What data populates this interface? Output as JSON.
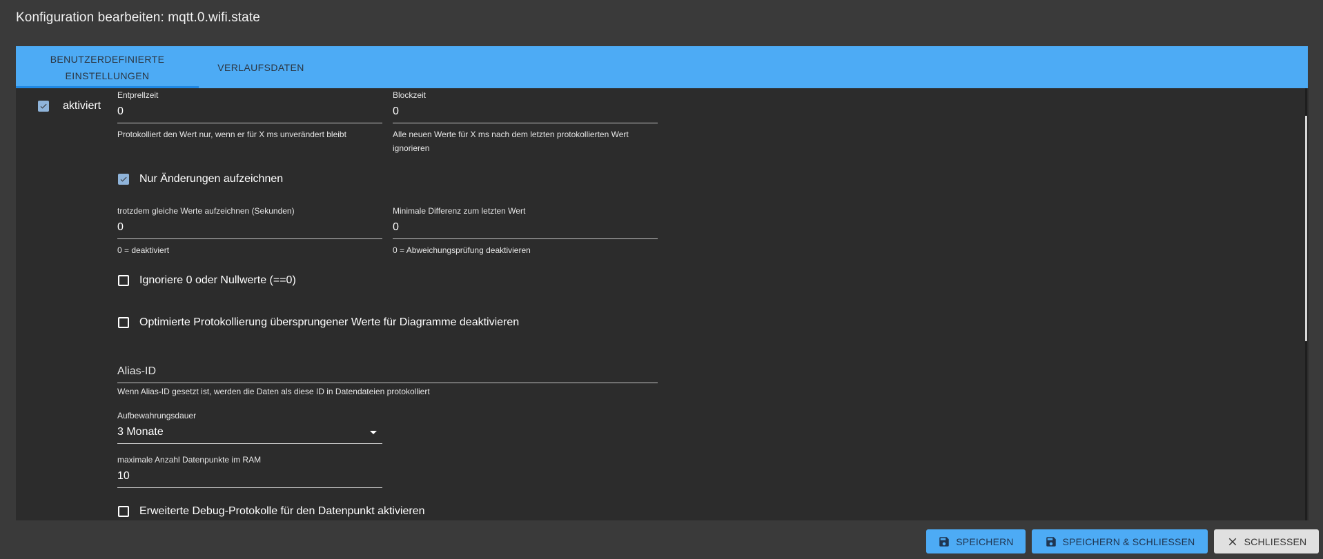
{
  "dialog": {
    "title": "Konfiguration bearbeiten: mqtt.0.wifi.state"
  },
  "tabs": [
    {
      "label": "Benutzerdefinierte Einstellungen"
    },
    {
      "label": "Verlaufsdaten"
    }
  ],
  "form": {
    "enabled": {
      "label": "aktiviert",
      "checked": true
    },
    "debounce": {
      "label": "Entprellzeit",
      "value": "0",
      "help": "Protokolliert den Wert nur, wenn er für X ms unverändert bleibt"
    },
    "blockTime": {
      "label": "Blockzeit",
      "value": "0",
      "help": "Alle neuen Werte für X ms nach dem letzten protokollierten Wert ignorieren"
    },
    "changesOnly": {
      "label": "Nur Änderungen aufzeichnen",
      "checked": true
    },
    "changesRelogInterval": {
      "label": "trotzdem gleiche Werte aufzeichnen (Sekunden)",
      "value": "0",
      "help": "0 = deaktiviert"
    },
    "changesMinDelta": {
      "label": "Minimale Differenz zum letzten Wert",
      "value": "0",
      "help": "0 = Abweichungsprüfung deaktivieren"
    },
    "ignoreZero": {
      "label": "Ignoriere 0 oder Nullwerte (==0)",
      "checked": false
    },
    "disableSkippedValueLogging": {
      "label": "Optimierte Protokollierung übersprungener Werte für Diagramme deaktivieren",
      "checked": false
    },
    "aliasId": {
      "placeholder": "Alias-ID",
      "value": "",
      "help": "Wenn Alias-ID gesetzt ist, werden die Daten als diese ID in Datendateien protokolliert"
    },
    "retention": {
      "label": "Aufbewahrungsdauer",
      "value": "3 Monate"
    },
    "maxLength": {
      "label": "maximale Anzahl Datenpunkte im RAM",
      "value": "10"
    },
    "enableDebugLogs": {
      "label": "Erweiterte Debug-Protokolle für den Datenpunkt aktivieren",
      "checked": false
    }
  },
  "buttons": {
    "save": "Speichern",
    "saveClose": "Speichern & Schliessen",
    "close": "Schliessen"
  },
  "colors": {
    "accent": "#4dabf5",
    "background": "#2c2c2c",
    "dialog": "#3a3a3a"
  }
}
